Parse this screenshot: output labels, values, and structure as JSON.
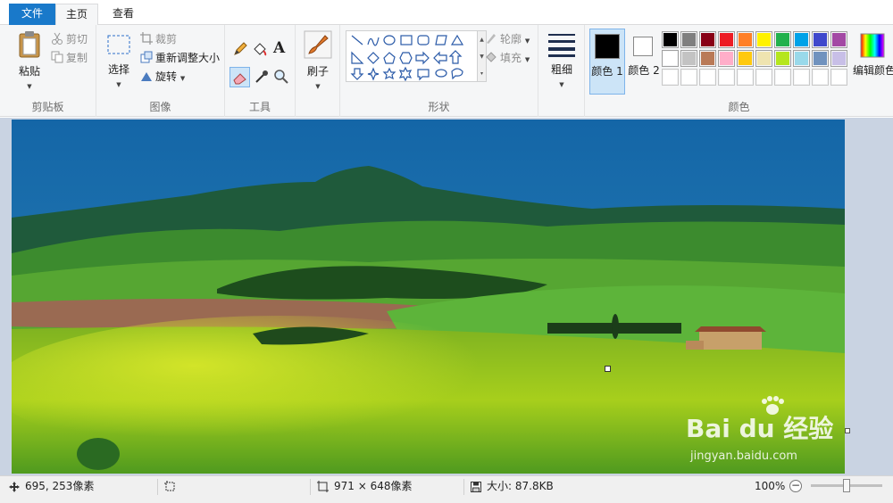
{
  "tabs": {
    "file": "文件",
    "home": "主页",
    "view": "查看"
  },
  "clipboard": {
    "paste": "粘贴",
    "cut": "剪切",
    "copy": "复制",
    "label": "剪贴板"
  },
  "image": {
    "select": "选择",
    "crop": "裁剪",
    "resize": "重新调整大小",
    "rotate": "旋转",
    "label": "图像"
  },
  "tools": {
    "label": "工具"
  },
  "brushes": {
    "label": "刷子"
  },
  "shapes": {
    "outline": "轮廓",
    "fill": "填充",
    "label": "形状"
  },
  "size": {
    "label": "粗细"
  },
  "colors": {
    "color1": "颜色 1",
    "color2": "颜色 2",
    "edit": "编辑颜色",
    "label": "颜色",
    "color1_value": "#000000",
    "color2_value": "#ffffff",
    "palette_row1": [
      "#000000",
      "#7f7f7f",
      "#880015",
      "#ed1c24",
      "#ff7f27",
      "#fff200",
      "#22b14c",
      "#00a2e8",
      "#3f48cc",
      "#a349a4"
    ],
    "palette_row2": [
      "#ffffff",
      "#c3c3c3",
      "#b97a57",
      "#ffaec9",
      "#ffc90e",
      "#efe4b0",
      "#b5e61d",
      "#99d9ea",
      "#7092be",
      "#c8bfe7"
    ],
    "palette_row3": [
      "#ffffff",
      "#ffffff",
      "#ffffff",
      "#ffffff",
      "#ffffff",
      "#ffffff",
      "#ffffff",
      "#ffffff",
      "#ffffff",
      "#ffffff"
    ]
  },
  "status": {
    "cursor_pos": "695, 253像素",
    "canvas_size": "971 × 648像素",
    "file_size": "大小: 87.8KB",
    "zoom": "100%"
  },
  "watermark": {
    "brand": "Bai du 经验",
    "url": "jingyan.baidu.com"
  },
  "accent": "#1979ca"
}
